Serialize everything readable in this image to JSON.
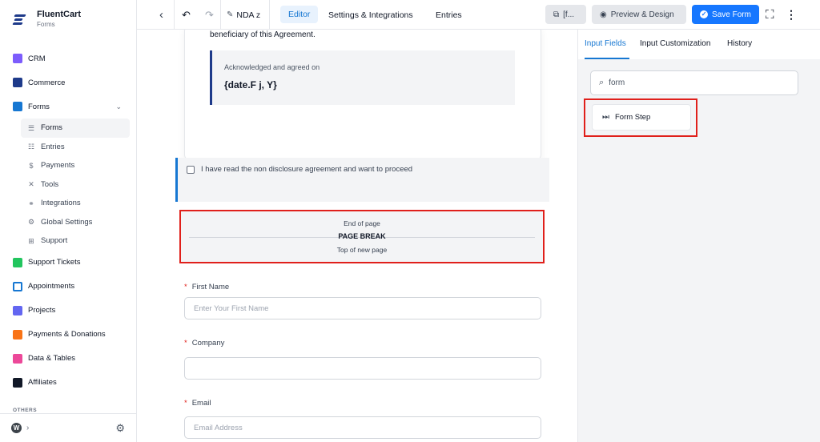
{
  "sidebar": {
    "brand": {
      "name": "FluentCart",
      "sub": "Forms"
    },
    "items": [
      {
        "label": "CRM",
        "color": "#7c5cfc"
      },
      {
        "label": "Commerce",
        "color": "#1e3a8a"
      },
      {
        "label": "Forms",
        "color": "#1677d2"
      }
    ],
    "forms_sub": [
      {
        "label": "Forms",
        "icon": "list-icon"
      },
      {
        "label": "Entries",
        "icon": "list-icon"
      },
      {
        "label": "Payments",
        "icon": "dollar-icon"
      },
      {
        "label": "Tools",
        "icon": "tools-icon"
      },
      {
        "label": "Integrations",
        "icon": "integrations-icon"
      },
      {
        "label": "Global Settings",
        "icon": "settings-icon"
      },
      {
        "label": "Support",
        "icon": "support-icon"
      }
    ],
    "more_items": [
      {
        "label": "Support Tickets",
        "color": "#22c55e"
      },
      {
        "label": "Appointments",
        "color": "#1677d2"
      },
      {
        "label": "Projects",
        "color": "#6366f1"
      },
      {
        "label": "Payments & Donations",
        "color": "#f97316"
      },
      {
        "label": "Data & Tables",
        "color": "#ec4899"
      },
      {
        "label": "Affiliates",
        "color": "#111827"
      }
    ],
    "others_label": "OTHERS"
  },
  "topbar": {
    "back": "‹",
    "undo": "↶",
    "redo": "↷",
    "form_name": "NDA z",
    "tabs": [
      "Editor",
      "Settings & Integrations",
      "Entries"
    ],
    "shortcode": "[f...",
    "preview_label": "Preview & Design",
    "save_label": "Save Form"
  },
  "main": {
    "beneficiary_text": "beneficiary of this Agreement.",
    "ack_label": "Acknowledged and agreed on",
    "ack_date": "{date.F j, Y}",
    "checkbox_label": "I have read the non disclosure agreement and want to proceed",
    "page_break": {
      "end": "End of page",
      "title": "PAGE BREAK",
      "top": "Top of new page"
    },
    "fields": [
      {
        "label": "First Name",
        "placeholder": "Enter Your First Name"
      },
      {
        "label": "Company",
        "placeholder": ""
      },
      {
        "label": "Email",
        "placeholder": "Email Address"
      }
    ],
    "required_mark": "*"
  },
  "rpanel": {
    "tabs": [
      "Input Fields",
      "Input Customization",
      "History"
    ],
    "search_value": "form",
    "result_label": "Form Step"
  },
  "colors": {
    "accent": "#1677d2",
    "highlight": "#e0201b"
  }
}
